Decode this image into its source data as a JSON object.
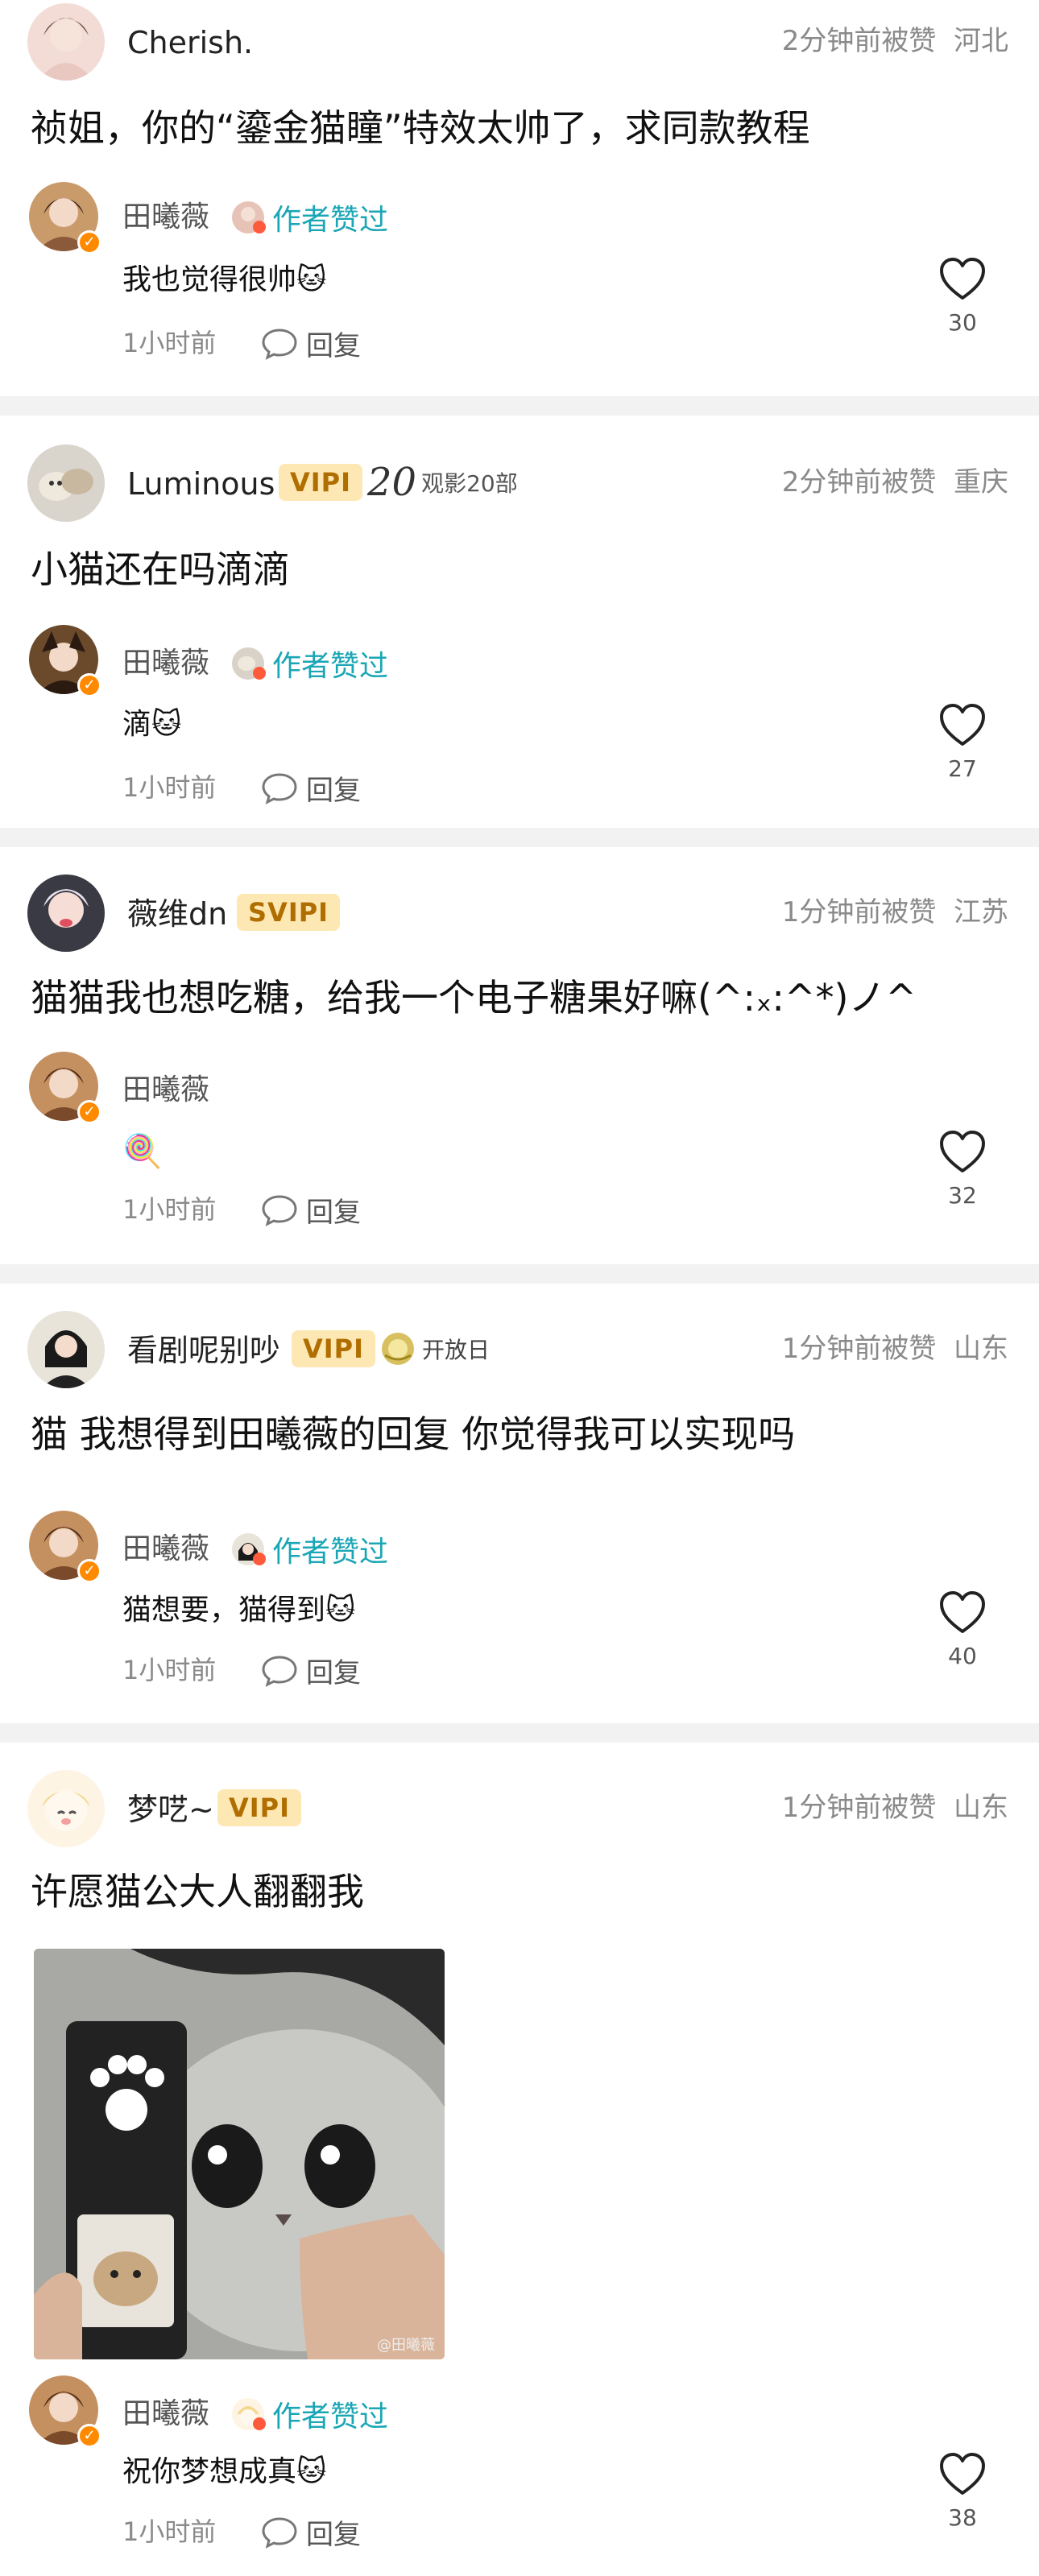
{
  "comments": [
    {
      "user": "Cherish.",
      "meta_time": "2分钟前被赞",
      "meta_loc": "河北",
      "text": "祯姐，你的“鎏金猫瞳”特效太帅了，求同款教程",
      "reply": {
        "name": "田曦薇",
        "liked_label": "作者赞过",
        "text": "我也觉得很帅🐱",
        "time": "1小时前",
        "reply_label": "回复",
        "likes": "30"
      }
    },
    {
      "user": "Luminous",
      "vip": "VIPⅠ",
      "badge_num": "20",
      "badge_text": "观影20部",
      "meta_time": "2分钟前被赞",
      "meta_loc": "重庆",
      "text": "小猫还在吗滴滴",
      "reply": {
        "name": "田曦薇",
        "liked_label": "作者赞过",
        "text": "滴🐱",
        "time": "1小时前",
        "reply_label": "回复",
        "likes": "27"
      }
    },
    {
      "user": "薇维dn",
      "vip": "SVIPⅠ",
      "meta_time": "1分钟前被赞",
      "meta_loc": "江苏",
      "text": "猫猫我也想吃糖，给我一个电子糖果好嘛(^:ₓ:^*)ノ^",
      "reply": {
        "name": "田曦薇",
        "text": "🍭",
        "time": "1小时前",
        "reply_label": "回复",
        "likes": "32"
      }
    },
    {
      "user": "看剧呢别吵",
      "vip": "VIPⅠ",
      "badge_text": "开放日",
      "meta_time": "1分钟前被赞",
      "meta_loc": "山东",
      "text": "猫 我想得到田曦薇的回复 你觉得我可以实现吗",
      "reply": {
        "name": "田曦薇",
        "liked_label": "作者赞过",
        "text": "猫想要，猫得到🐱",
        "time": "1小时前",
        "reply_label": "回复",
        "likes": "40"
      }
    },
    {
      "user": "梦呓~",
      "vip": "VIPⅠ",
      "meta_time": "1分钟前被赞",
      "meta_loc": "山东",
      "text": "许愿猫公大人翻翻我",
      "image_watermark": "@田曦薇",
      "reply": {
        "name": "田曦薇",
        "liked_label": "作者赞过",
        "text": "祝你梦想成真🐱",
        "time": "1小时前",
        "reply_label": "回复",
        "likes": "38"
      }
    }
  ],
  "colors": {
    "accent": "#1ba6b5",
    "vip_bg": "#fde7b3",
    "vip_text": "#b06e00",
    "separator": "#f2f2f2",
    "verify": "#ff8a00"
  }
}
